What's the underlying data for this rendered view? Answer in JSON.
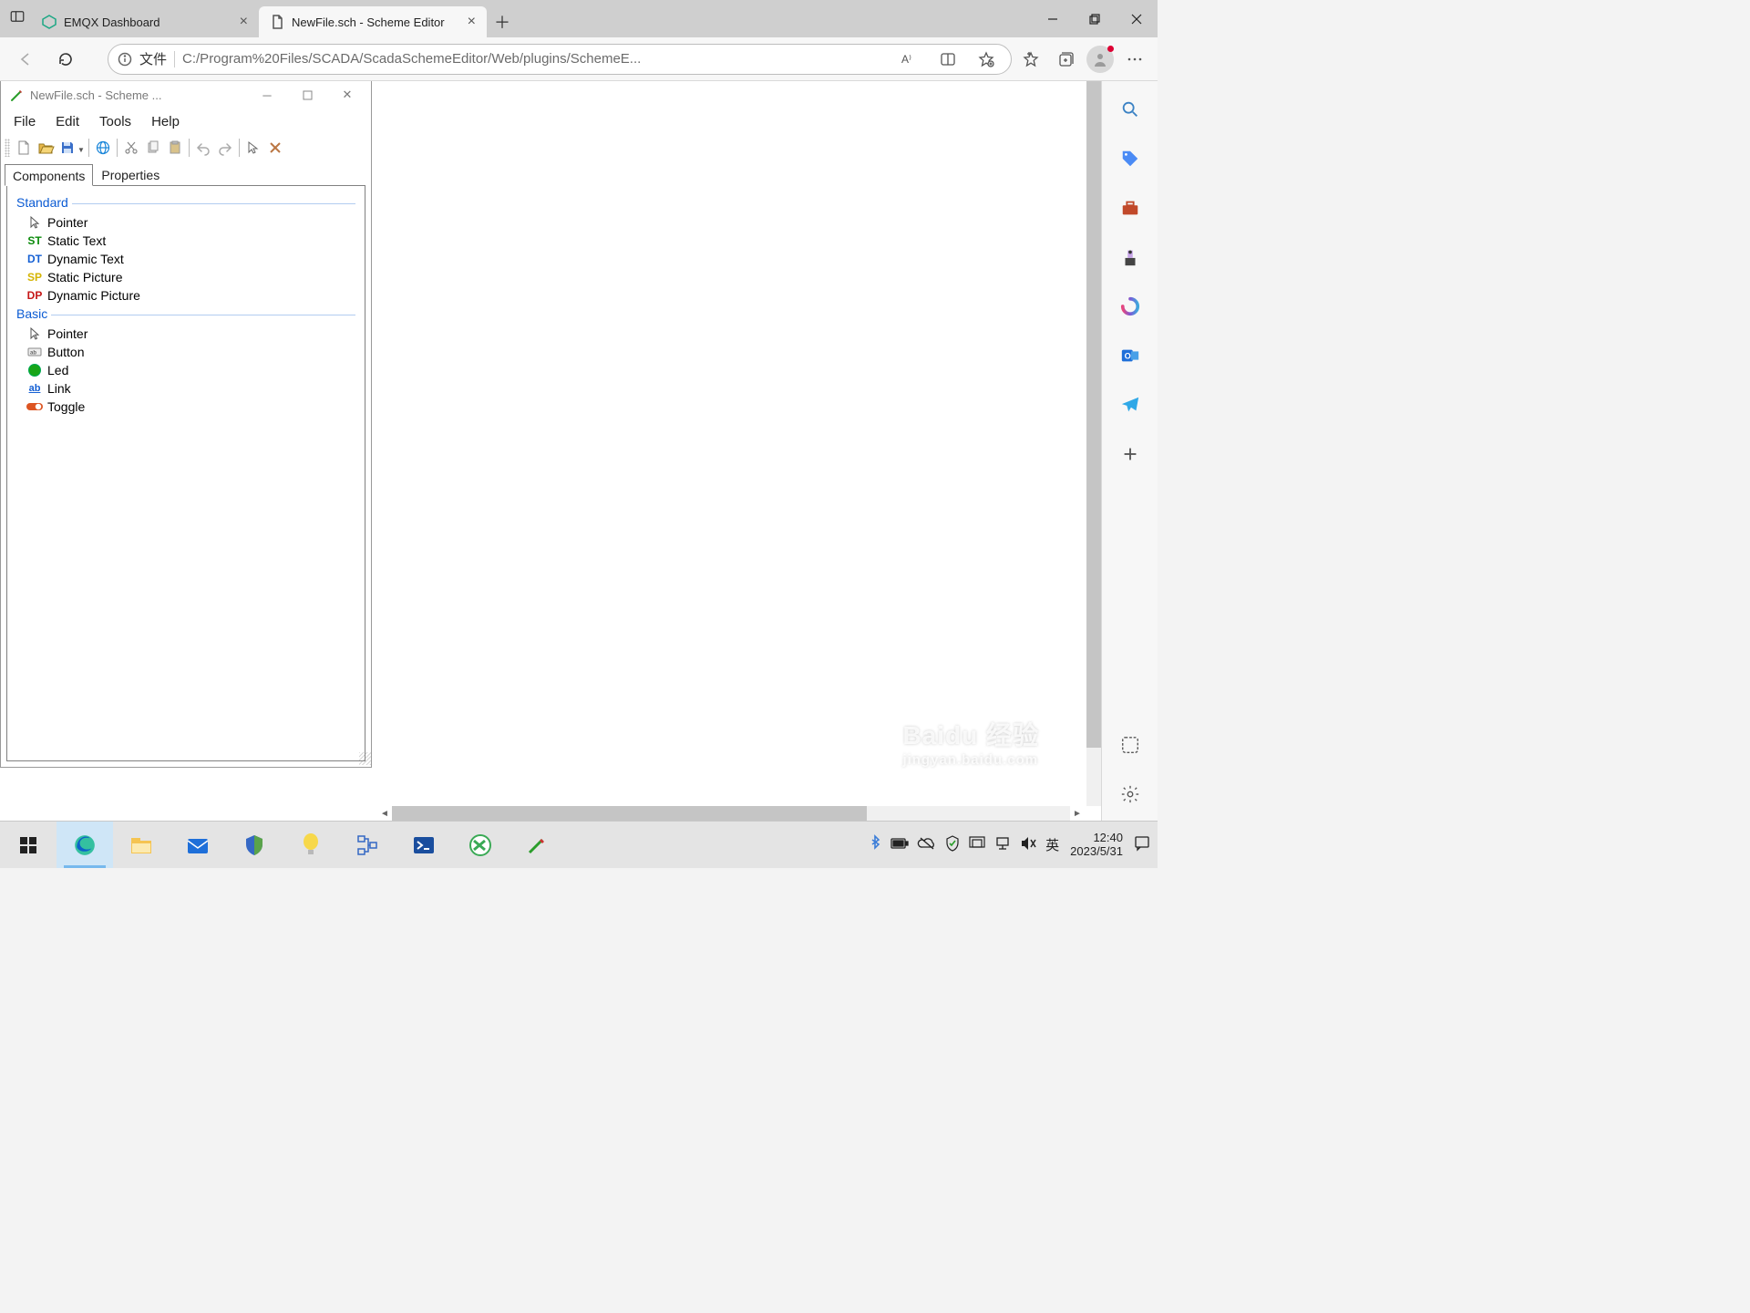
{
  "browser": {
    "tabs": [
      {
        "title": "EMQX Dashboard",
        "icon": "emqx"
      },
      {
        "title": "NewFile.sch - Scheme Editor",
        "icon": "file"
      }
    ],
    "active_tab": 1,
    "url_prefix": "文件",
    "url": "C:/Program%20Files/SCADA/ScadaSchemeEditor/Web/plugins/SchemeE..."
  },
  "scheme_editor": {
    "title": "NewFile.sch - Scheme ...",
    "menu": [
      "File",
      "Edit",
      "Tools",
      "Help"
    ],
    "panel_tabs": [
      "Components",
      "Properties"
    ],
    "active_panel_tab": 0,
    "groups": [
      {
        "name": "Standard",
        "items": [
          {
            "icon": "pointer",
            "label": "Pointer"
          },
          {
            "icon": "ST",
            "color": "#0a8a0a",
            "label": "Static Text"
          },
          {
            "icon": "DT",
            "color": "#1560d4",
            "label": "Dynamic Text"
          },
          {
            "icon": "SP",
            "color": "#d4b400",
            "label": "Static Picture"
          },
          {
            "icon": "DP",
            "color": "#c51616",
            "label": "Dynamic Picture"
          }
        ]
      },
      {
        "name": "Basic",
        "items": [
          {
            "icon": "pointer",
            "label": "Pointer"
          },
          {
            "icon": "button",
            "label": "Button"
          },
          {
            "icon": "led",
            "label": "Led"
          },
          {
            "icon": "link",
            "label": "Link"
          },
          {
            "icon": "toggle",
            "label": "Toggle"
          }
        ]
      }
    ]
  },
  "taskbar": {
    "ime": "英",
    "time": "12:40",
    "date": "2023/5/31"
  },
  "watermark": {
    "brand": "Baidu 经验",
    "sub": "jingyan.baidu.com"
  }
}
